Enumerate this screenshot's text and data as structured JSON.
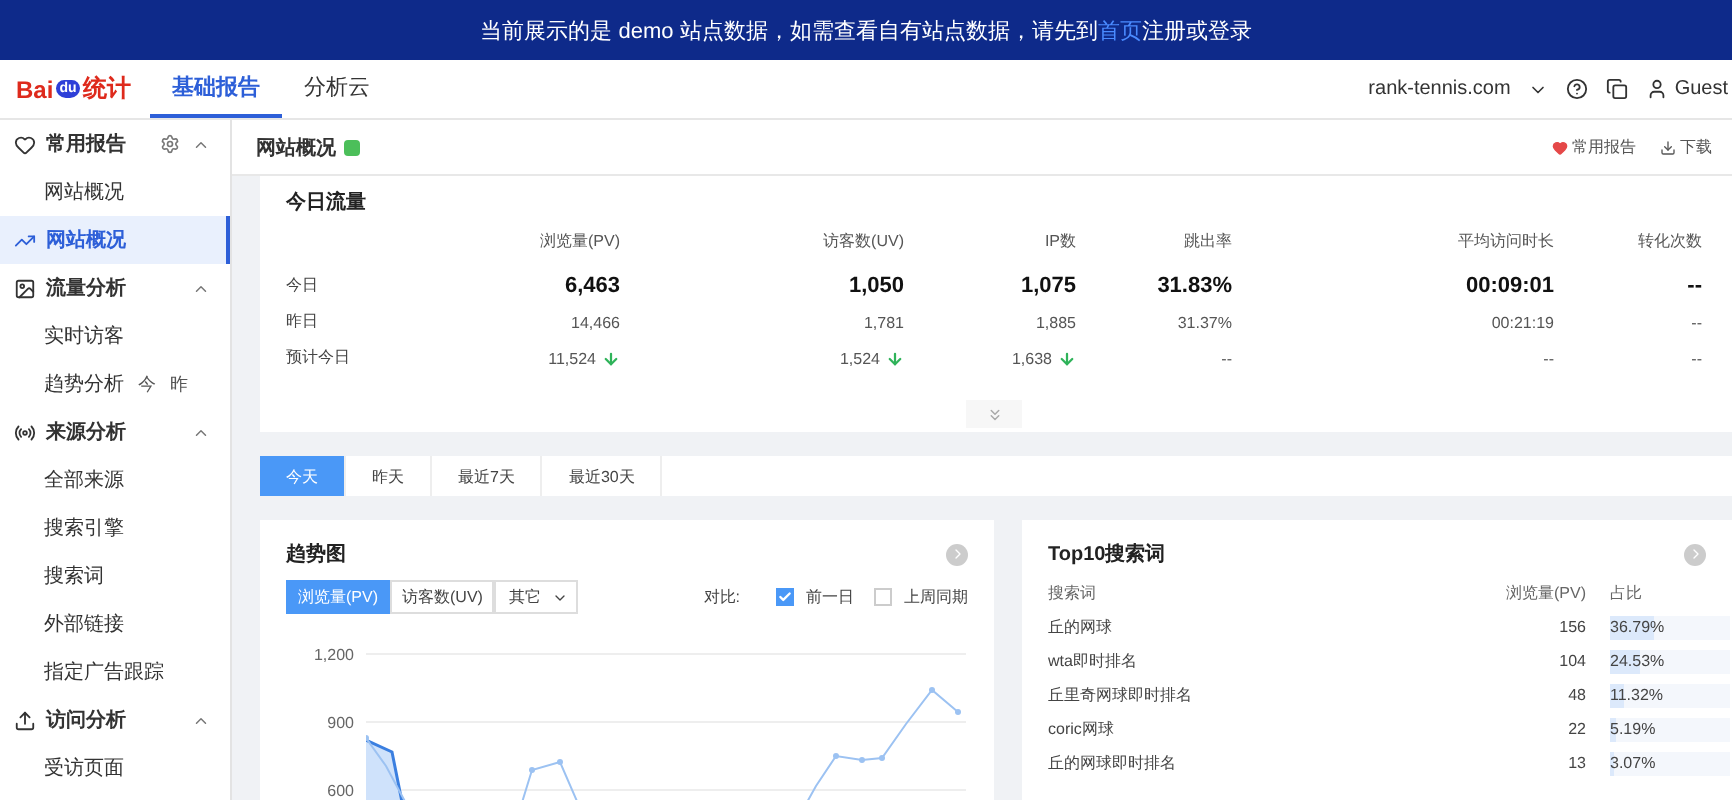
{
  "banner": {
    "before": "当前展示的是 demo 站点数据，如需查看自有站点数据，请先到",
    "link": "首页",
    "after": "注册或登录"
  },
  "logo": {
    "left": "Bai",
    "badge": "du",
    "right": "统计"
  },
  "nav_tabs": [
    {
      "label": "基础报告",
      "selected": true
    },
    {
      "label": "分析云",
      "selected": false
    }
  ],
  "site": "rank-tennis.com",
  "user": "Guest",
  "sidebar": [
    {
      "label": "常用报告",
      "selected": false,
      "expanded": true,
      "settings": true,
      "children": [
        {
          "label": "网站概况",
          "selected": false
        }
      ]
    },
    {
      "label": "网站概况",
      "selected": true
    },
    {
      "label": "流量分析",
      "selected": false,
      "expanded": true,
      "children": [
        {
          "label": "实时访客",
          "selected": false
        },
        {
          "label": "趋势分析",
          "selected": false,
          "tags": [
            "今",
            "昨"
          ]
        }
      ]
    },
    {
      "label": "来源分析",
      "selected": false,
      "expanded": true,
      "children": [
        {
          "label": "全部来源",
          "selected": false
        },
        {
          "label": "搜索引擎",
          "selected": false
        },
        {
          "label": "搜索词",
          "selected": false
        },
        {
          "label": "外部链接",
          "selected": false
        },
        {
          "label": "指定广告跟踪",
          "selected": false
        }
      ]
    },
    {
      "label": "访问分析",
      "selected": false,
      "expanded": true,
      "children": [
        {
          "label": "受访页面",
          "selected": false
        }
      ]
    }
  ],
  "breadcrumb": {
    "title": "网站概况",
    "actions": [
      "常用报告",
      "下载"
    ]
  },
  "today": {
    "title": "今日流量",
    "columns": [
      "浏览量(PV)",
      "访客数(UV)",
      "IP数",
      "跳出率",
      "平均访问时长",
      "转化次数"
    ],
    "rows": [
      {
        "label": "今日",
        "kind": "main",
        "cells": [
          {
            "value": "6,463",
            "falling": false
          },
          {
            "value": "1,050",
            "falling": false
          },
          {
            "value": "1,075",
            "falling": false
          },
          {
            "value": "31.83%",
            "falling": false
          },
          {
            "value": "00:09:01",
            "falling": false
          },
          {
            "value": "--",
            "falling": false
          }
        ]
      },
      {
        "label": "昨日",
        "kind": "normal",
        "cells": [
          {
            "value": "14,466",
            "falling": false
          },
          {
            "value": "1,781",
            "falling": false
          },
          {
            "value": "1,885",
            "falling": false
          },
          {
            "value": "31.37%",
            "falling": false
          },
          {
            "value": "00:21:19",
            "falling": false
          },
          {
            "value": "--",
            "falling": false
          }
        ]
      },
      {
        "label": "预计今日",
        "kind": "normal",
        "cells": [
          {
            "value": "11,524",
            "falling": true
          },
          {
            "value": "1,524",
            "falling": true
          },
          {
            "value": "1,638",
            "falling": true
          },
          {
            "value": "--",
            "falling": false
          },
          {
            "value": "--",
            "falling": false
          },
          {
            "value": "--",
            "falling": false
          }
        ]
      }
    ]
  },
  "date_tabs": [
    {
      "label": "今天",
      "selected": true
    },
    {
      "label": "昨天",
      "selected": false
    },
    {
      "label": "最近7天",
      "selected": false
    },
    {
      "label": "最近30天",
      "selected": false
    }
  ],
  "trend": {
    "title": "趋势图",
    "metrics": [
      {
        "label": "浏览量(PV)",
        "selected": true
      },
      {
        "label": "访客数(UV)",
        "selected": false
      }
    ],
    "more": "其它",
    "compare_label": "对比:",
    "compare": [
      {
        "label": "前一日",
        "checked": true
      },
      {
        "label": "上周同期",
        "checked": false
      }
    ],
    "y_ticks": [
      "1,200",
      "900",
      "600"
    ]
  },
  "top10": {
    "title": "Top10搜索词",
    "columns": [
      "搜索词",
      "浏览量(PV)",
      "占比"
    ],
    "rows": [
      {
        "term": "丘的网球",
        "pv": "156",
        "share": "36.79%",
        "level": 0.3679
      },
      {
        "term": "wta即时排名",
        "pv": "104",
        "share": "24.53%",
        "level": 0.2453
      },
      {
        "term": "丘里奇网球即时排名",
        "pv": "48",
        "share": "11.32%",
        "level": 0.1132
      },
      {
        "term": "coric网球",
        "pv": "22",
        "share": "5.19%",
        "level": 0.0519
      },
      {
        "term": "丘的网球即时排名",
        "pv": "13",
        "share": "3.07%",
        "level": 0.0307
      }
    ]
  }
}
